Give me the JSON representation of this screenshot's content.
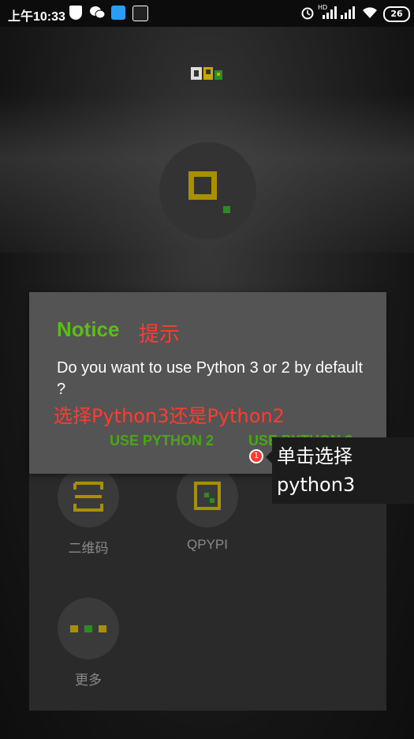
{
  "status_bar": {
    "time": "上午10:33",
    "hd_label": "HD",
    "battery": "26"
  },
  "dialog": {
    "title": "Notice",
    "title_annotation": "提示",
    "message": "Do you want to use Python 3 or 2 by default ?",
    "message_annotation": "选择Python3还是Python2",
    "button_python2": "USE PYTHON 2",
    "button_python3": "USE PYTHON 3"
  },
  "grid": {
    "items": [
      {
        "label": "二维码",
        "icon": "qr-scan-icon"
      },
      {
        "label": "QPYPI",
        "icon": "qpypi-icon"
      },
      {
        "label": "更多",
        "icon": "more-dots-icon"
      }
    ]
  },
  "annotation": {
    "badge": "1",
    "text": "单击选择python3"
  },
  "colors": {
    "accent_green": "#5bbd17",
    "annotation_red": "#ff3b30",
    "logo_gold": "#a89000"
  }
}
